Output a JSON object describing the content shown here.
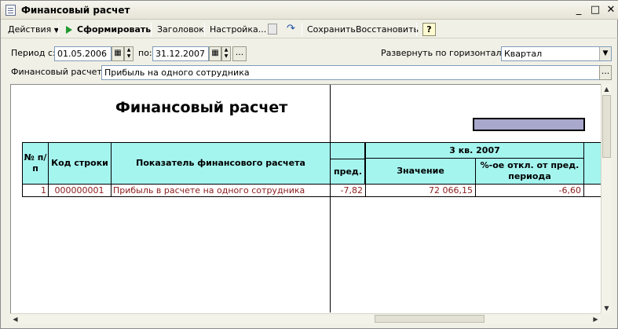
{
  "window": {
    "title": "Финансовый расчет",
    "minimize": "_",
    "restore": "□",
    "close": "✕"
  },
  "toolbar": {
    "actions": "Действия",
    "generate": "Сформировать",
    "header": "Заголовок",
    "settings": "Настройка...",
    "save": "Сохранить",
    "restore": "Восстановить",
    "help": "?"
  },
  "form": {
    "period_from_label": "Период с:",
    "period_from": "01.05.2006",
    "period_to_label": "по:",
    "period_to": "31.12.2007",
    "expand_label": "Развернуть по горизонтали:",
    "expand_value": "Квартал",
    "calc_label": "Финансовый расчет:",
    "calc_value": "Прибыль на одного сотрудника",
    "dots": "..."
  },
  "report": {
    "title": "Финансовый расчет",
    "columns": {
      "num": "№ п/п",
      "code": "Код строки",
      "indicator": "Показатель финансового расчета",
      "prev_partial": "пред.",
      "quarter": "3 кв. 2007",
      "value": "Значение",
      "deviation": "%-ое откл. от пред. периода"
    },
    "rows": [
      {
        "num": "1",
        "code": "000000001",
        "indicator": "Прибыль в расчете на одного сотрудника",
        "prev_partial": "-7,82",
        "value": "72 066,15",
        "deviation": "-6,60"
      }
    ]
  }
}
